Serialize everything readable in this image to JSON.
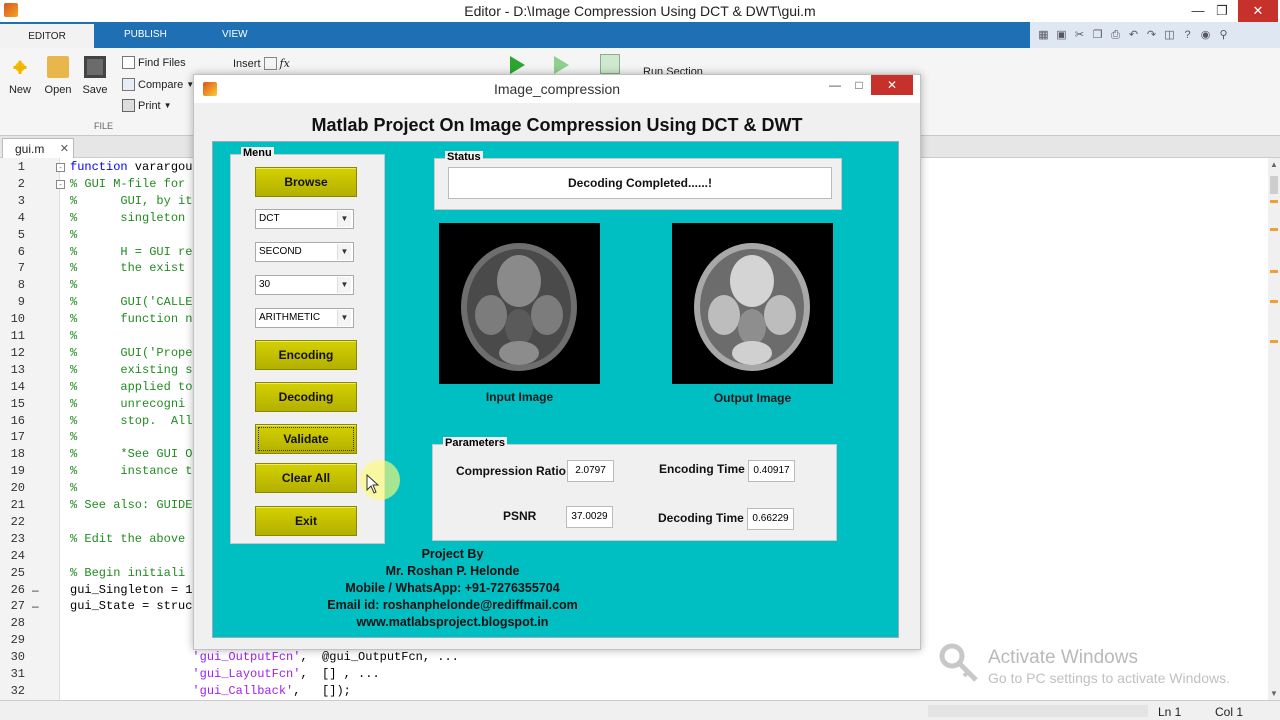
{
  "editor": {
    "window_title": "Editor - D:\\Image Compression Using DCT &  DWT\\gui.m",
    "ribbon_tabs": [
      "EDITOR",
      "PUBLISH",
      "VIEW"
    ],
    "toolstrip": {
      "new": "New",
      "open": "Open",
      "save": "Save",
      "find_files": "Find Files",
      "compare": "Compare",
      "print": "Print",
      "insert": "Insert",
      "run_section": "Run Section",
      "group_file": "FILE"
    },
    "doc_tab": "gui.m",
    "lines": [
      {
        "n": "1",
        "segs": [
          [
            "kw",
            "function"
          ],
          [
            "tx",
            " varargou"
          ]
        ]
      },
      {
        "n": "2",
        "segs": [
          [
            "cm",
            "% GUI M-file for"
          ]
        ]
      },
      {
        "n": "3",
        "segs": [
          [
            "cm",
            "%      GUI, by it"
          ]
        ]
      },
      {
        "n": "4",
        "segs": [
          [
            "cm",
            "%      singleton"
          ]
        ]
      },
      {
        "n": "5",
        "segs": [
          [
            "cm",
            "%"
          ]
        ]
      },
      {
        "n": "6",
        "segs": [
          [
            "cm",
            "%      H = GUI re"
          ]
        ]
      },
      {
        "n": "7",
        "segs": [
          [
            "cm",
            "%      the exist"
          ]
        ]
      },
      {
        "n": "8",
        "segs": [
          [
            "cm",
            "%"
          ]
        ]
      },
      {
        "n": "9",
        "segs": [
          [
            "cm",
            "%      GUI('CALLE"
          ]
        ]
      },
      {
        "n": "10",
        "segs": [
          [
            "cm",
            "%      function n"
          ]
        ]
      },
      {
        "n": "11",
        "segs": [
          [
            "cm",
            "%"
          ]
        ]
      },
      {
        "n": "12",
        "segs": [
          [
            "cm",
            "%      GUI('Prope"
          ]
        ]
      },
      {
        "n": "13",
        "segs": [
          [
            "cm",
            "%      existing s"
          ]
        ]
      },
      {
        "n": "14",
        "segs": [
          [
            "cm",
            "%      applied to"
          ]
        ]
      },
      {
        "n": "15",
        "segs": [
          [
            "cm",
            "%      unrecogni"
          ]
        ]
      },
      {
        "n": "16",
        "segs": [
          [
            "cm",
            "%      stop.  All"
          ]
        ]
      },
      {
        "n": "17",
        "segs": [
          [
            "cm",
            "%"
          ]
        ]
      },
      {
        "n": "18",
        "segs": [
          [
            "cm",
            "%      *See GUI O"
          ]
        ]
      },
      {
        "n": "19",
        "segs": [
          [
            "cm",
            "%      instance t"
          ]
        ]
      },
      {
        "n": "20",
        "segs": [
          [
            "cm",
            "%"
          ]
        ]
      },
      {
        "n": "21",
        "segs": [
          [
            "cm",
            "% See also: GUIDE"
          ]
        ]
      },
      {
        "n": "22",
        "segs": []
      },
      {
        "n": "23",
        "segs": [
          [
            "cm",
            "% Edit the above"
          ]
        ]
      },
      {
        "n": "24",
        "segs": []
      },
      {
        "n": "25",
        "segs": [
          [
            "cm",
            "% Begin initiali"
          ]
        ]
      },
      {
        "n": "26",
        "segs": [
          [
            "tx",
            "gui_Singleton = 1"
          ]
        ]
      },
      {
        "n": "27",
        "segs": [
          [
            "tx",
            "gui_State = struc"
          ]
        ]
      },
      {
        "n": "28",
        "segs": []
      },
      {
        "n": "29",
        "segs": []
      },
      {
        "n": "30",
        "segs": [
          [
            "str",
            "                 'gui_OutputFcn'"
          ],
          [
            "tx",
            ",  @gui_OutputFcn, ..."
          ]
        ]
      },
      {
        "n": "31",
        "segs": [
          [
            "str",
            "                 'gui_LayoutFcn'"
          ],
          [
            "tx",
            ",  [] , ..."
          ]
        ]
      },
      {
        "n": "32",
        "segs": [
          [
            "str",
            "                 'gui_Callback'"
          ],
          [
            "tx",
            ",   []);"
          ]
        ]
      }
    ],
    "status_ln": "Ln  1",
    "status_col": "Col  1",
    "watermark_line1": "Activate Windows",
    "watermark_line2": "Go to PC settings to activate Windows."
  },
  "figure": {
    "window_title": "Image_compression",
    "heading": "Matlab Project On Image Compression Using DCT & DWT",
    "menu": {
      "title": "Menu",
      "browse": "Browse",
      "transform": "DCT",
      "level": "SECOND",
      "quality": "30",
      "coding": "ARITHMETIC",
      "encoding": "Encoding",
      "decoding": "Decoding",
      "validate": "Validate",
      "clear_all": "Clear All",
      "exit": "Exit"
    },
    "status": {
      "title": "Status",
      "message": "Decoding Completed......!"
    },
    "input_caption": "Input Image",
    "output_caption": "Output Image",
    "parameters": {
      "title": "Parameters",
      "compression_ratio_label": "Compression Ratio",
      "compression_ratio": "2.0797",
      "encoding_time_label": "Encoding Time",
      "encoding_time": "0.40917",
      "psnr_label": "PSNR",
      "psnr": "37.0029",
      "decoding_time_label": "Decoding Time",
      "decoding_time": "0.66229"
    },
    "credits": [
      "Project By",
      "Mr. Roshan P. Helonde",
      "Mobile / WhatsApp: +91-7276355704",
      "Email id: roshanphelonde@rediffmail.com",
      "www.matlabsproject.blogspot.in"
    ]
  }
}
